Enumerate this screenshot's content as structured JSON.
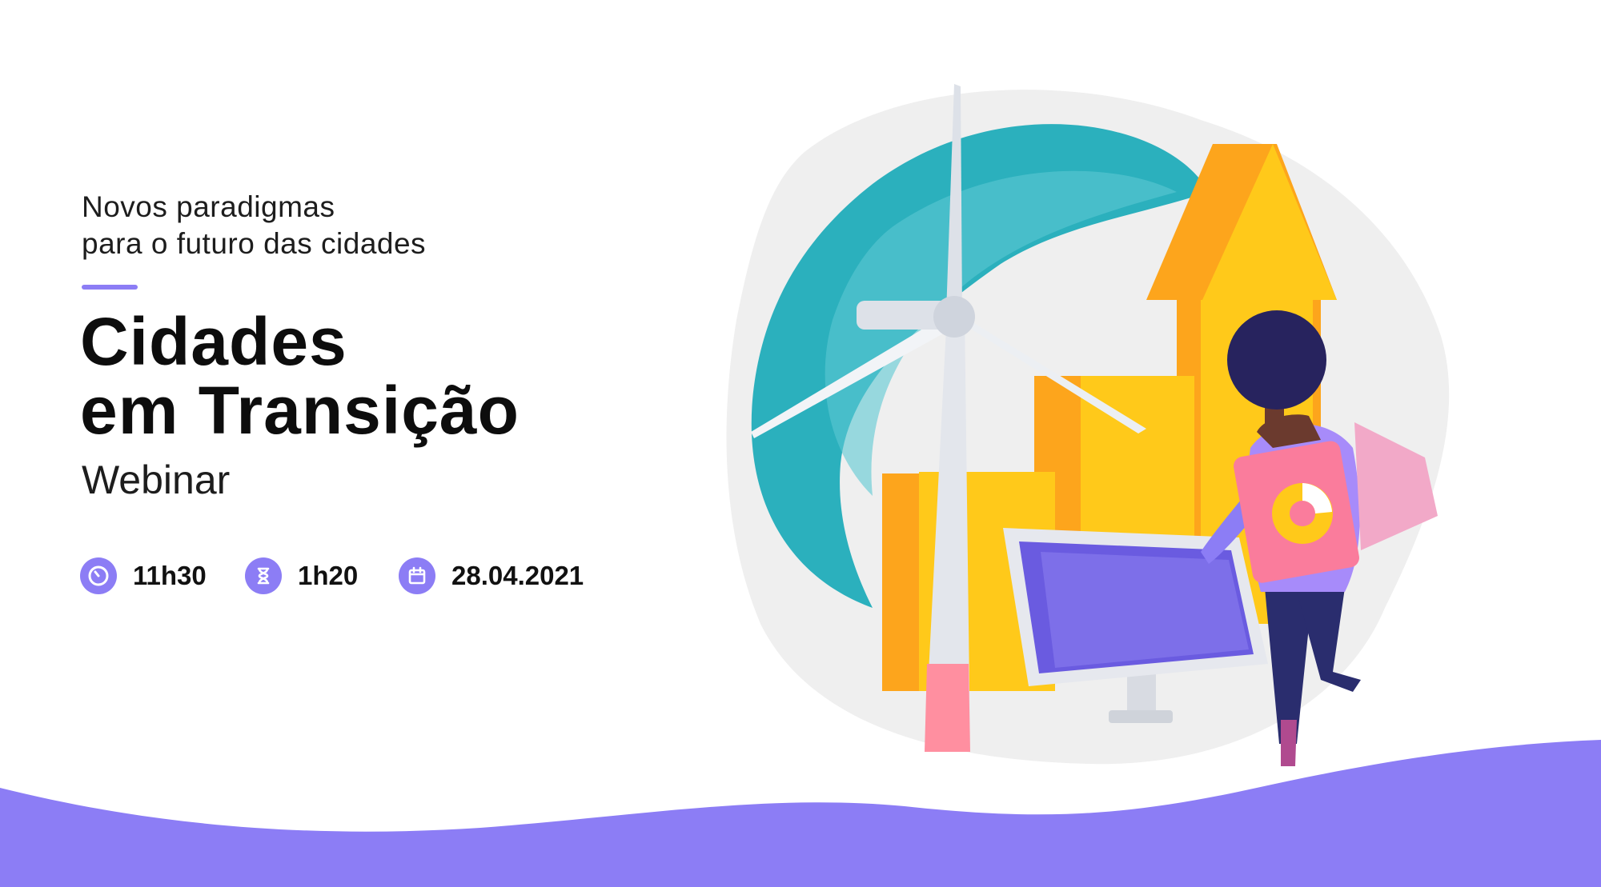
{
  "header": {
    "subtitle_line1": "Novos paradigmas",
    "subtitle_line2": "para o futuro das cidades"
  },
  "title": {
    "line1": "Cidades",
    "line2": "em Transição"
  },
  "tagline": "Webinar",
  "details": {
    "time": "11h30",
    "duration": "1h20",
    "date": "28.04.2021"
  },
  "icons": {
    "time": "clock-icon",
    "duration": "hourglass-icon",
    "date": "calendar-icon"
  },
  "colors": {
    "accent": "#8c7df5",
    "teal": "#2bb0bd",
    "orange": "#fda51c",
    "yellow": "#ffc91a"
  }
}
